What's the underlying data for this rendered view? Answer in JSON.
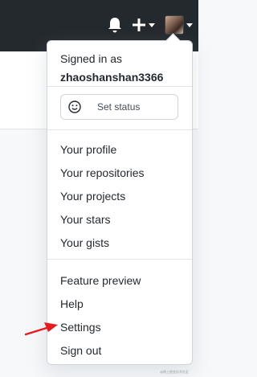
{
  "topbar": {
    "bell_icon": "bell-icon",
    "plus_icon": "plus-icon",
    "avatar_icon": "user-avatar"
  },
  "menu": {
    "signed_in_label": "Signed in as",
    "username": "zhaoshanshan3366",
    "status_button": {
      "icon": "smiley-icon",
      "label": "Set status"
    },
    "items": [
      "Your profile",
      "Your repositories",
      "Your projects",
      "Your stars",
      "Your gists",
      "Feature preview",
      "Help",
      "Settings",
      "Sign out"
    ]
  },
  "annotation": {
    "arrow_color": "#e8191f",
    "points_to": "Settings"
  },
  "watermark": "@稀土掘金技术社区",
  "colors": {
    "header_bg": "#24292e",
    "menu_text": "#24292e",
    "divider": "#e1e4e8",
    "page_bg": "#f6f8fa"
  }
}
